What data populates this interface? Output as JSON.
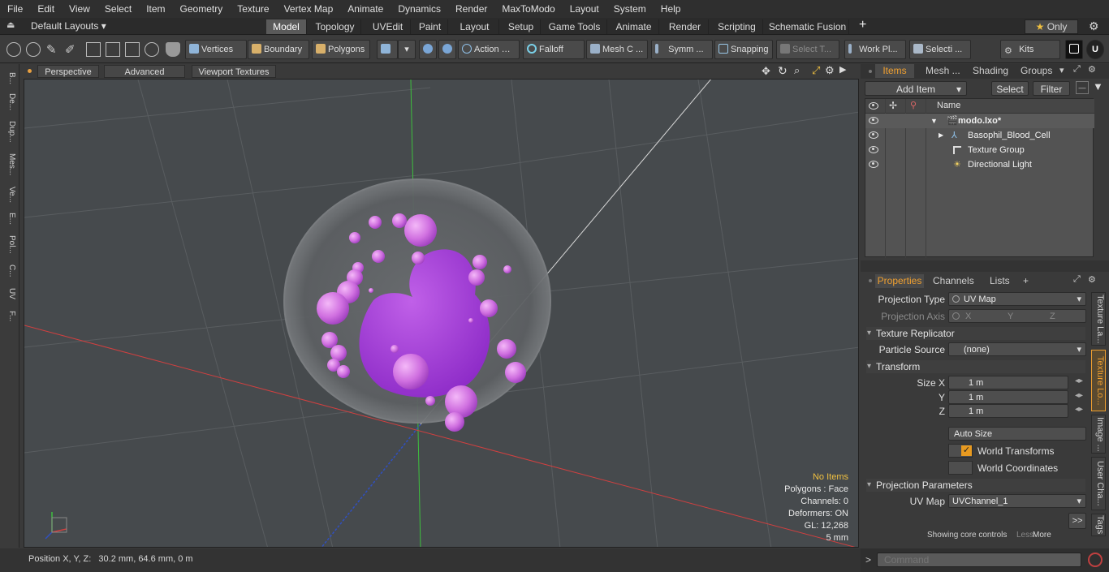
{
  "menu": [
    "File",
    "Edit",
    "View",
    "Select",
    "Item",
    "Geometry",
    "Texture",
    "Vertex Map",
    "Animate",
    "Dynamics",
    "Render",
    "MaxToModo",
    "Layout",
    "System",
    "Help"
  ],
  "layout": {
    "dropdown": "Default Layouts",
    "tabs": [
      "Model",
      "Topology",
      "UVEdit",
      "Paint",
      "Layout",
      "Setup",
      "Game Tools",
      "Animate",
      "Render",
      "Scripting",
      "Schematic Fusion"
    ],
    "active_tab": "Model",
    "add": "+",
    "only": "Only"
  },
  "toolbar": {
    "vertices": "Vertices",
    "boundary": "Boundary",
    "polygons": "Polygons",
    "action": "Action",
    "falloff": "Falloff",
    "mesh": "Mesh C ...",
    "symm": "Symm ...",
    "snapping": "Snapping",
    "select_t": "Select T...",
    "work_pl": "Work Pl...",
    "selecti": "Selecti ...",
    "kits": "Kits"
  },
  "left_tabs": [
    "B...",
    "De...",
    "Dup...",
    "Mes...",
    "Ve...",
    "E...",
    "Pol...",
    "C...",
    "UV",
    "F..."
  ],
  "viewport": {
    "perspective": "Perspective",
    "advanced": "Advanced",
    "textures": "Viewport Textures",
    "stats": {
      "items": "No Items",
      "polygons": "Polygons : Face",
      "channels": "Channels: 0",
      "deformers": "Deformers: ON",
      "gl": "GL: 12,268",
      "scale": "5 mm"
    },
    "colors": {
      "items": "#f0c040",
      "blob": "#a040d0",
      "sphere": "#d070e0"
    }
  },
  "status": {
    "position": "Position X, Y, Z:   30.2 mm, 64.6 mm, 0 m"
  },
  "items_panel": {
    "tabs": [
      "Items",
      "Mesh ...",
      "Shading",
      "Groups"
    ],
    "active": "Items",
    "add_item": "Add Item",
    "select": "Select",
    "filter": "Filter",
    "name_header": "Name",
    "rows": [
      {
        "label": "modo.lxo*",
        "bold": true
      },
      {
        "label": "Basophil_Blood_Cell"
      },
      {
        "label": "Texture Group"
      },
      {
        "label": "Directional Light"
      }
    ]
  },
  "properties": {
    "tabs": [
      "Properties",
      "Channels",
      "Lists",
      "+"
    ],
    "active": "Properties",
    "projection_type_label": "Projection Type",
    "projection_type": "UV Map",
    "projection_axis_label": "Projection Axis",
    "axis_x": "X",
    "axis_y": "Y",
    "axis_z": "Z",
    "texture_replicator": "Texture Replicator",
    "particle_source_label": "Particle Source",
    "particle_source": "(none)",
    "transform": "Transform",
    "size_x_label": "Size X",
    "size_y_label": "Y",
    "size_z_label": "Z",
    "size_x": "1 m",
    "size_y": "1 m",
    "size_z": "1 m",
    "auto_size": "Auto Size",
    "world_transforms": "World Transforms",
    "world_coordinates": "World Coordinates",
    "projection_parameters": "Projection Parameters",
    "uv_map_label": "UV Map",
    "uv_map": "UVChannel_1",
    "more_arrow": ">>",
    "showing": "Showing core controls",
    "less": "Less",
    "more": "More",
    "world_transforms_checked": true,
    "world_coordinates_checked": false
  },
  "right_tabs": [
    "Texture La...",
    "Texture Lo...",
    "Image ...",
    "User Cha...",
    "Tags"
  ],
  "command": {
    "placeholder": "Command",
    "prompt": ">"
  }
}
